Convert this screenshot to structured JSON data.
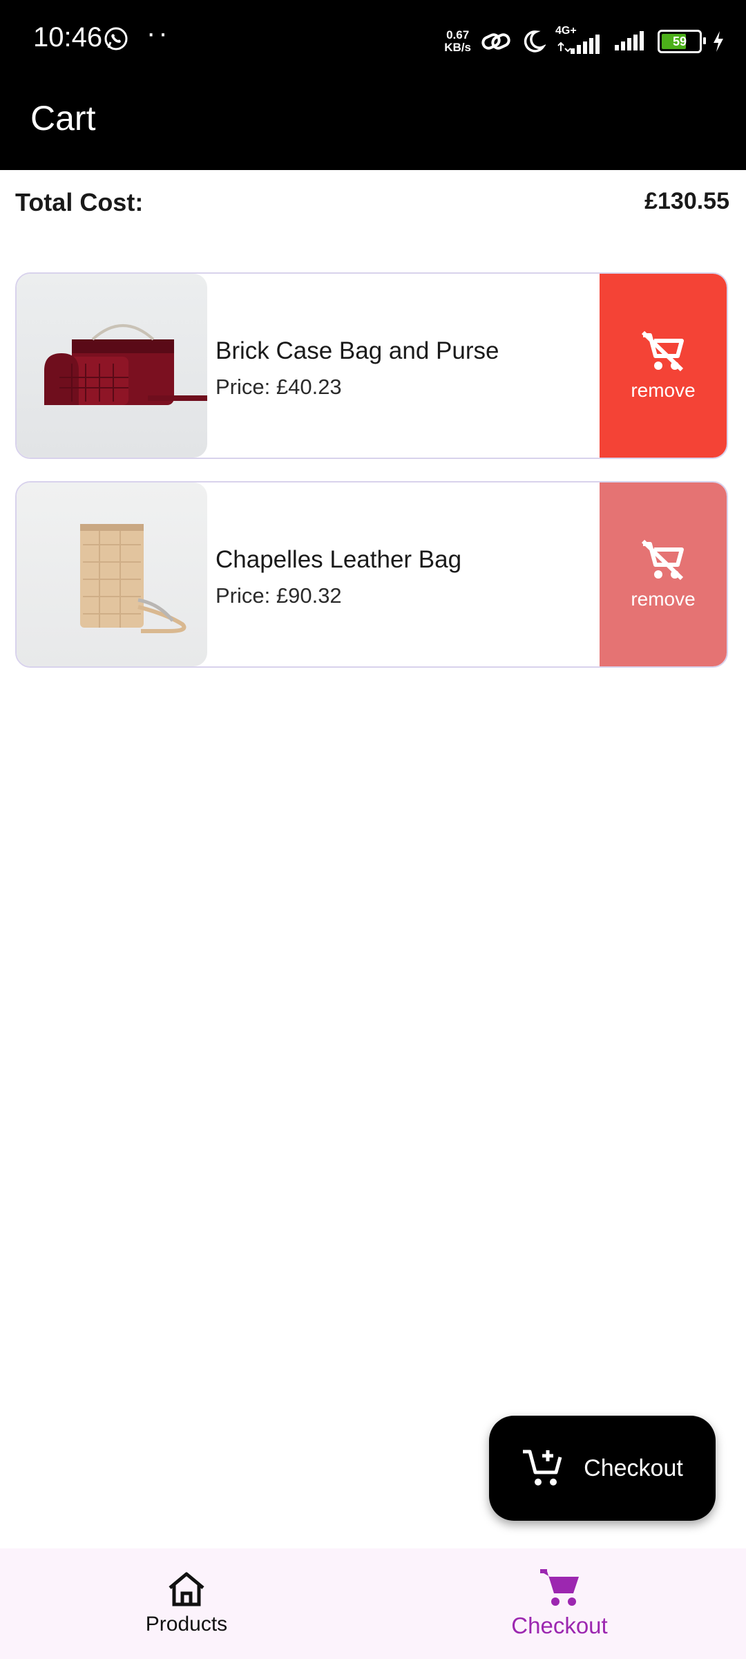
{
  "status_bar": {
    "time": "10:46",
    "dots": "··",
    "speed_value": "0.67",
    "speed_unit": "KB/s",
    "network": "4G+",
    "battery": "59"
  },
  "app_bar": {
    "title": "Cart"
  },
  "summary": {
    "label": "Total Cost:",
    "value": "£130.55"
  },
  "cart_items": [
    {
      "name": "Brick Case Bag and Purse",
      "price": "Price: £40.23",
      "remove_label": "remove",
      "remove_color": "#f44336"
    },
    {
      "name": "Chapelles Leather Bag",
      "price": "Price: £90.32",
      "remove_label": "remove",
      "remove_color": "#e57373"
    }
  ],
  "fab": {
    "label": "Checkout",
    "icon": "cart-add-icon"
  },
  "bottom_nav": {
    "items": [
      {
        "label": "Products",
        "icon": "home-icon",
        "color": "#111111"
      },
      {
        "label": "Checkout",
        "icon": "cart-icon",
        "color": "#9c27b0",
        "active": true
      }
    ]
  },
  "colors": {
    "accent": "#9c27b0",
    "card_border": "#d8d2ec"
  }
}
